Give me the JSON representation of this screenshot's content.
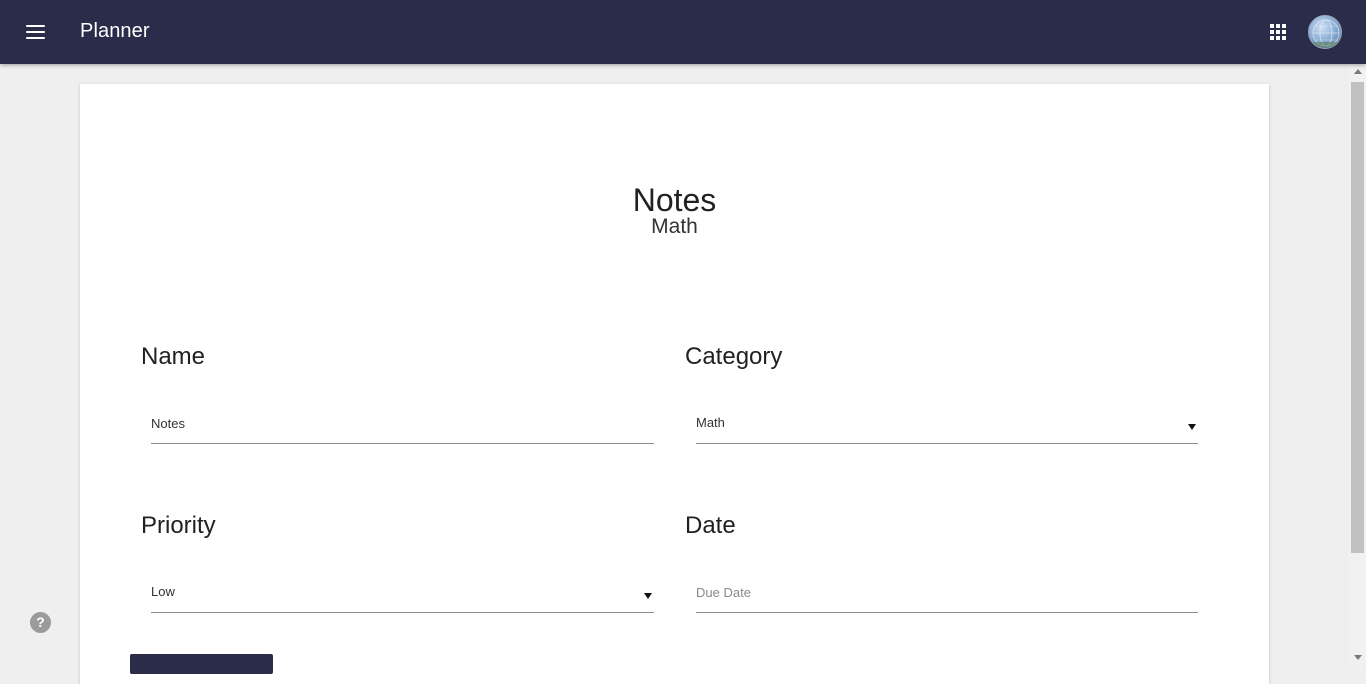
{
  "header": {
    "app_title": "Planner",
    "menu_icon": "menu-icon",
    "apps_icon": "apps-grid-icon",
    "avatar_icon": "account-avatar"
  },
  "page": {
    "title": "Notes",
    "subtitle": "Math"
  },
  "form": {
    "name": {
      "label": "Name",
      "value": "Notes"
    },
    "category": {
      "label": "Category",
      "value": "Math"
    },
    "priority": {
      "label": "Priority",
      "value": "Low"
    },
    "date": {
      "label": "Date",
      "placeholder": "Due Date",
      "value": ""
    }
  },
  "help": {
    "glyph": "?"
  },
  "colors": {
    "primary": "#2b2c49",
    "background": "#efefef",
    "card": "#ffffff"
  }
}
